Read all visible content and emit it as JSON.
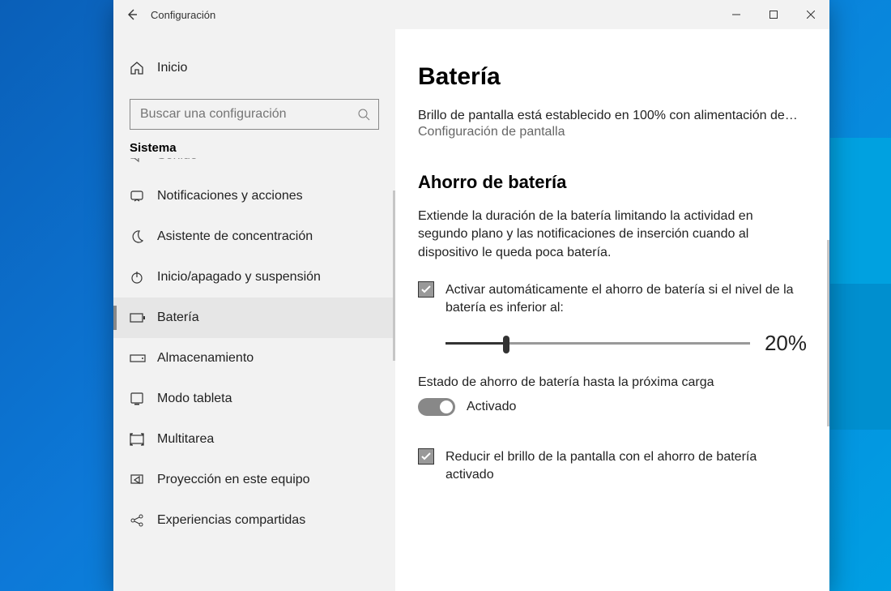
{
  "window": {
    "title": "Configuración"
  },
  "sidebar": {
    "home": "Inicio",
    "search_placeholder": "Buscar una configuración",
    "group": "Sistema",
    "items": [
      {
        "icon": "sound-icon",
        "label": "Sonido",
        "cut": true
      },
      {
        "icon": "notification-icon",
        "label": "Notificaciones y acciones"
      },
      {
        "icon": "moon-icon",
        "label": "Asistente de concentración"
      },
      {
        "icon": "power-icon",
        "label": "Inicio/apagado y suspensión"
      },
      {
        "icon": "battery-icon",
        "label": "Batería",
        "selected": true
      },
      {
        "icon": "storage-icon",
        "label": "Almacenamiento"
      },
      {
        "icon": "tablet-icon",
        "label": "Modo tableta"
      },
      {
        "icon": "multitask-icon",
        "label": "Multitarea"
      },
      {
        "icon": "project-icon",
        "label": "Proyección en este equipo"
      },
      {
        "icon": "shared-icon",
        "label": "Experiencias compartidas"
      }
    ]
  },
  "page": {
    "title": "Batería",
    "bright_line": "Brillo de pantalla está establecido en 100% con alimentación de…",
    "bright_link": "Configuración de pantalla",
    "saver_title": "Ahorro de batería",
    "saver_desc": "Extiende la duración de la batería limitando la actividad en segundo plano y las notificaciones de inserción cuando al dispositivo le queda poca batería.",
    "auto_check_label": "Activar automáticamente el ahorro de batería si el nivel de la batería es inferior al:",
    "slider_value": 20,
    "slider_display": "20%",
    "state_label": "Estado de ahorro de batería hasta la próxima carga",
    "toggle_label": "Activado",
    "reduce_label": "Reducir el brillo de la pantalla con el ahorro de batería activado"
  }
}
